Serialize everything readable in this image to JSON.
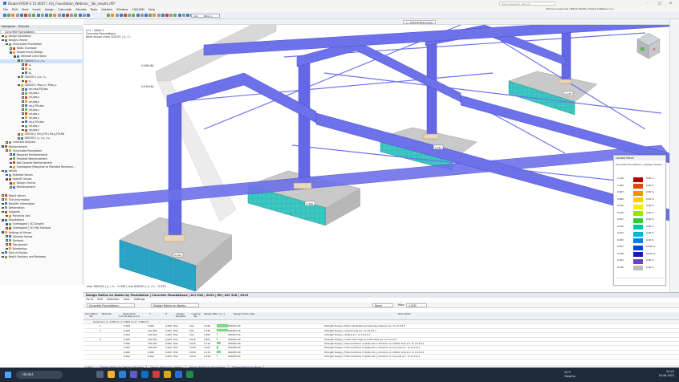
{
  "app": {
    "title": "Dlubal RFEM 6.15.0007 | A2|_Foundation_Webinar__No_results.rf6*",
    "search_placeholder": "Type a keyword (Alt+Q)",
    "license": "Online License AAI | Martin Motlik | Dlubal Software s.r.o."
  },
  "menu": [
    "File",
    "Edit",
    "View",
    "Insert",
    "Assign",
    "Calculate",
    "Results",
    "Tools",
    "Options",
    "Window",
    "CAD-BIM",
    "Help"
  ],
  "toolbar": {
    "combo": "LC1",
    "combo_name": "Wind 1",
    "default_layer": "1 - Default Base Layer"
  },
  "navigator": {
    "title": "Navigator - Results",
    "selector": "Concrete Foundations",
    "items": [
      {
        "t": "Design Situations",
        "lvl": 0,
        "cb": false
      },
      {
        "t": "Design Checks",
        "lvl": 0,
        "cb": true
      },
      {
        "t": "Unincluded Foundation",
        "lvl": 1,
        "cb": false
      },
      {
        "t": "Static Envelope",
        "lvl": 2,
        "cb": false
      },
      {
        "t": "Geotechnical Design",
        "lvl": 2,
        "cb": true
      },
      {
        "t": "Ultimate Limit State",
        "lvl": 3,
        "cb": true
      },
      {
        "t": "SD0201 | ηₛ / fₘ",
        "lvl": 4,
        "cb": true,
        "sel": true
      },
      {
        "t": "ηₐ",
        "lvl": 5,
        "cb": false
      },
      {
        "t": "ηₐ",
        "lvl": 5,
        "cb": false
      },
      {
        "t": "σₘ",
        "lvl": 5,
        "cb": false
      },
      {
        "t": "SD0202 | ηₐs / ηₐ",
        "lvl": 4,
        "cb": false
      },
      {
        "t": "ηₐ",
        "lvl": 5,
        "cb": false
      },
      {
        "t": "SD0203 | Maxₐ,s / Maxₐ,s",
        "lvl": 4,
        "cb": false
      },
      {
        "t": "ηd,max,FM,abs",
        "lvl": 5,
        "cb": false
      },
      {
        "t": "ηd,abs,s",
        "lvl": 5,
        "cb": false
      },
      {
        "t": "ηd,abs,s",
        "lvl": 5,
        "cb": false
      },
      {
        "t": "ηd,abs,s",
        "lvl": 5,
        "cb": false
      },
      {
        "t": "ηd,y,FM,abs",
        "lvl": 5,
        "cb": false
      },
      {
        "t": "ηd,abs,s",
        "lvl": 5,
        "cb": false
      },
      {
        "t": "ηd,abs,s",
        "lvl": 5,
        "cb": false
      },
      {
        "t": "ηd,abs,s",
        "lvl": 5,
        "cb": false
      },
      {
        "t": "ηd,x,FM,abs",
        "lvl": 5,
        "cb": false
      },
      {
        "t": "ηd,abs,s",
        "lvl": 5,
        "cb": false
      },
      {
        "t": "ηd,abs,s",
        "lvl": 5,
        "cb": false
      },
      {
        "t": "SD0204 | Rd,y,FM / Rd,y,FM,Rd",
        "lvl": 4,
        "cb": false
      },
      {
        "t": "SD0205 | ηₐ | ηₐ | ηₐ",
        "lvl": 4,
        "cb": false
      },
      {
        "t": "Concrete Analysis",
        "lvl": 1,
        "cb": false
      },
      {
        "t": "Reinforcement",
        "lvl": 0,
        "cb": true
      },
      {
        "t": "Unincluded Foundation",
        "lvl": 1,
        "cb": false
      },
      {
        "t": "Required Reinforcement",
        "lvl": 2,
        "cb": false
      },
      {
        "t": "Provided Reinforcement",
        "lvl": 2,
        "cb": false
      },
      {
        "t": "Not Covered Reinforcement",
        "lvl": 2,
        "cb": false
      },
      {
        "t": "Overlapped (Required vs Provided Reinforce...",
        "lvl": 2,
        "cb": false
      },
      {
        "t": "Values",
        "lvl": 0,
        "cb": true
      },
      {
        "t": "Selected Values",
        "lvl": 1,
        "cb": false
      },
      {
        "t": "Specific Values",
        "lvl": 1,
        "cb": true
      },
      {
        "t": "Design Checks",
        "lvl": 2,
        "cb": true
      },
      {
        "t": "Reinforcement",
        "lvl": 2,
        "cb": false
      },
      {
        "t": "",
        "lvl": 0,
        "cb": false
      },
      {
        "t": "Result Values",
        "lvl": 0,
        "cb": false
      },
      {
        "t": "Title Information",
        "lvl": 0,
        "cb": false
      },
      {
        "t": "Max/Min Information",
        "lvl": 0,
        "cb": false
      },
      {
        "t": "Deformation",
        "lvl": 0,
        "cb": false
      },
      {
        "t": "Supports",
        "lvl": 0,
        "cb": false
      },
      {
        "t": "Punching Axis",
        "lvl": 1,
        "cb": false
      },
      {
        "t": "Foundations",
        "lvl": 0,
        "cb": true
      },
      {
        "t": "Overlapped | 3D Graphic",
        "lvl": 1,
        "cb": true
      },
      {
        "t": "Overlapped | 2D Plot Sections",
        "lvl": 1,
        "cb": false
      },
      {
        "t": "Settings of Values",
        "lvl": 0,
        "cb": true
      },
      {
        "t": "Extreme Values",
        "lvl": 1,
        "cb": false
      },
      {
        "t": "Symbols",
        "lvl": 1,
        "cb": false
      },
      {
        "t": "Transparent",
        "lvl": 1,
        "cb": false
      },
      {
        "t": "Numbering",
        "lvl": 1,
        "cb": false
      },
      {
        "t": "Type of display",
        "lvl": 0,
        "cb": false
      },
      {
        "t": "Result Sections and Releases",
        "lvl": 0,
        "cb": false
      }
    ]
  },
  "viewport": {
    "lc_label": "LC1 - Wind 1",
    "addon": "Concrete Foundations",
    "check": "Node design check SD0201 | ηₛ / fₘ",
    "scale1": "0.008 kN/",
    "scale2": "0.016 kN/",
    "maxmin": "max SD0201 | ηₛ / fₘ : 0.346 | min SD0201 | ηₛ / fₘ : 0.225",
    "node_labels": [
      "0.294",
      "0.346",
      "0.291",
      "0.225"
    ]
  },
  "control_panel": {
    "title": "Control Panel",
    "subtitle": "Concrete Foundations | Design Checks ...",
    "legend": [
      {
        "v": "1.100",
        "c": "#b30000",
        "p": "0.00 %"
      },
      {
        "v": "1.050",
        "c": "#e34800",
        "p": "0.00 %"
      },
      {
        "v": "0.967",
        "c": "#ff8c00",
        "p": "0.00 %"
      },
      {
        "v": "0.880",
        "c": "#ffcc00",
        "p": "0.00 %"
      },
      {
        "v": "0.792",
        "c": "#f2ee00",
        "p": "0.00 %"
      },
      {
        "v": "0.705",
        "c": "#9be600",
        "p": "0.00 %"
      },
      {
        "v": "0.617",
        "c": "#2bd12b",
        "p": "0.00 %"
      },
      {
        "v": "0.530",
        "c": "#00c9a8",
        "p": "0.00 %"
      },
      {
        "v": "0.442",
        "c": "#00b4e6",
        "p": "0.00 %"
      },
      {
        "v": "0.355",
        "c": "#0081f0",
        "p": "0.00 %"
      },
      {
        "v": "0.267",
        "c": "#0048d8",
        "p": "50.00 %"
      },
      {
        "v": "0.180",
        "c": "#1a1ab8",
        "p": "50.00 %"
      },
      {
        "v": "0.092",
        "c": "#6e40c9",
        "p": "0.00 %"
      },
      {
        "v": "0.020",
        "c": "#bcbcbc",
        "p": "0.00 %"
      }
    ]
  },
  "bottom": {
    "title": "Design Ratios on Nodes by Foundation | Concrete Foundations | ACI 318 | 2019 | EN | ACI 318 | 2019",
    "menu": [
      "Go To",
      "Edit",
      "Selection",
      "View",
      "Settings"
    ],
    "addon_select": "Concrete Foundations",
    "view_select": "Design Ratios on Nodes",
    "filter_none": "None",
    "max_label": "Max:",
    "max_value": "1.000",
    "headers": [
      "Foundation No.",
      "Node No.",
      "Node Point Coordinates [m] X",
      "Y",
      "Z",
      "Design Situation",
      "Loading No.",
      "Design Ratio η [--]",
      "Design Check Type",
      "Description"
    ],
    "group_row": "Centricus | 4 : 4.000 m | Y: 4.000 m | Z: -0.600 m",
    "rows": [
      {
        "f": "",
        "n": "1",
        "x": "0.000",
        "y": "0.000",
        "z": "0.000",
        "ds": "DS2",
        "lo": "CO1",
        "r": "0.346",
        "ck": "SD0201.00",
        "d": "Strength Design | Factor allowable soil bearing pressure acc. to 13.3.6.3"
      },
      {
        "f": "",
        "n": "4",
        "x": "0.000",
        "y": "150.000",
        "z": "0.000",
        "ds": "DS2",
        "lo": "CO1",
        "r": "0.346",
        "ck": "SD0202.00",
        "d": "Strength Design | Overturning acc. to 13.2.6.7"
      },
      {
        "f": "",
        "n": "",
        "x": "0.000",
        "y": "150.000",
        "z": "0.000",
        "ds": "DS2",
        "lo": "CO1",
        "r": "0.002",
        "ck": "SD0203.00",
        "d": "Strength Design | Sliding acc. to 13.2.6.7"
      },
      {
        "f": "",
        "n": "4",
        "x": "0.000",
        "y": "150.000",
        "z": "0.000",
        "ds": "DS2",
        "lo": "CO16",
        "r": "0.001",
        "ck": "SD0204.00",
        "d": "Strength Design | Loads with large eccentricities acc. to 13.3.6.1"
      },
      {
        "f": "",
        "n": "",
        "x": "0.000",
        "y": "150.000",
        "z": "0.000",
        "ds": "DS2",
        "lo": "CO16",
        "r": "0.119",
        "ck": "SD0205.00",
        "d": "Strength Design | Flexural failure of plate into x-direction on bottom side acc. to 13.2.6.4"
      },
      {
        "f": "",
        "n": "",
        "x": "0.000",
        "y": "150.000",
        "z": "0.000",
        "ds": "DS2",
        "lo": "CO16",
        "r": "0.062",
        "ck": "SD0205.00",
        "d": "Strength Design | Flexural failure of plate into x-direction on top side acc. to 13.2.6.4"
      },
      {
        "f": "",
        "n": "",
        "x": "0.000",
        "y": "0.000",
        "z": "0.000",
        "ds": "DS2",
        "lo": "CO16",
        "r": "0.119",
        "ck": "SD0205.00",
        "d": "Strength Design | Flexural failure of plate into y-direction on bottom side acc. to 13.2.6.4"
      },
      {
        "f": "",
        "n": "",
        "x": "0.000",
        "y": "0.000",
        "z": "0.000",
        "ds": "DS2",
        "lo": "CO16",
        "r": "0.018",
        "ck": "SD0205.00",
        "d": "Strength Design | Flexural failure of plate into y-direction on top side acc. to 13.2.6.4"
      }
    ],
    "pager": "1 of 4",
    "tabs": [
      "Design Ratios by Design Situation",
      "Design Ratios by Loading",
      "Design Ratios by Foundation",
      "Design Ratios by Node"
    ]
  },
  "taskbar": {
    "search": "Hledat",
    "temp": "22°C",
    "weather": "Oblačno",
    "time": "20:42",
    "date": "29.08.2025"
  }
}
